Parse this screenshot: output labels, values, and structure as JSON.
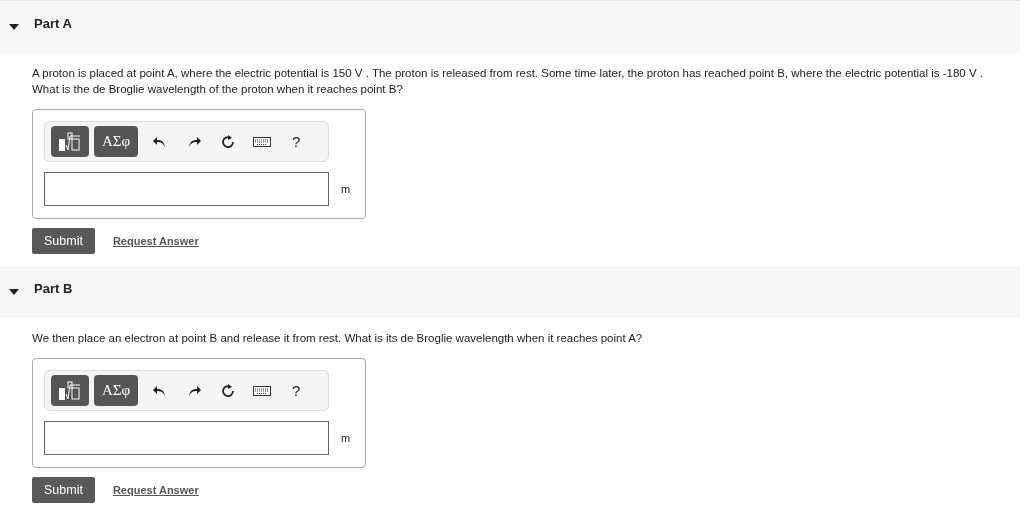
{
  "parts": [
    {
      "title": "Part A",
      "expanded": true,
      "question": "A proton is placed at point A, where the electric potential is 150 V .  The proton is released from rest.  Some time later, the proton has reached point B, where the electric potential is -180 V .  What is the de Broglie wavelength of the proton when it reaches point B?",
      "toolbar": {
        "symbols": "ΑΣφ",
        "help": "?"
      },
      "unit": "m",
      "submit": "Submit",
      "request": "Request Answer"
    },
    {
      "title": "Part B",
      "expanded": true,
      "question": "We then place an electron at point B and release it from rest.  What is its de Broglie wavelength when it reaches point A?",
      "toolbar": {
        "symbols": "ΑΣφ",
        "help": "?"
      },
      "unit": "m",
      "submit": "Submit",
      "request": "Request Answer"
    }
  ]
}
